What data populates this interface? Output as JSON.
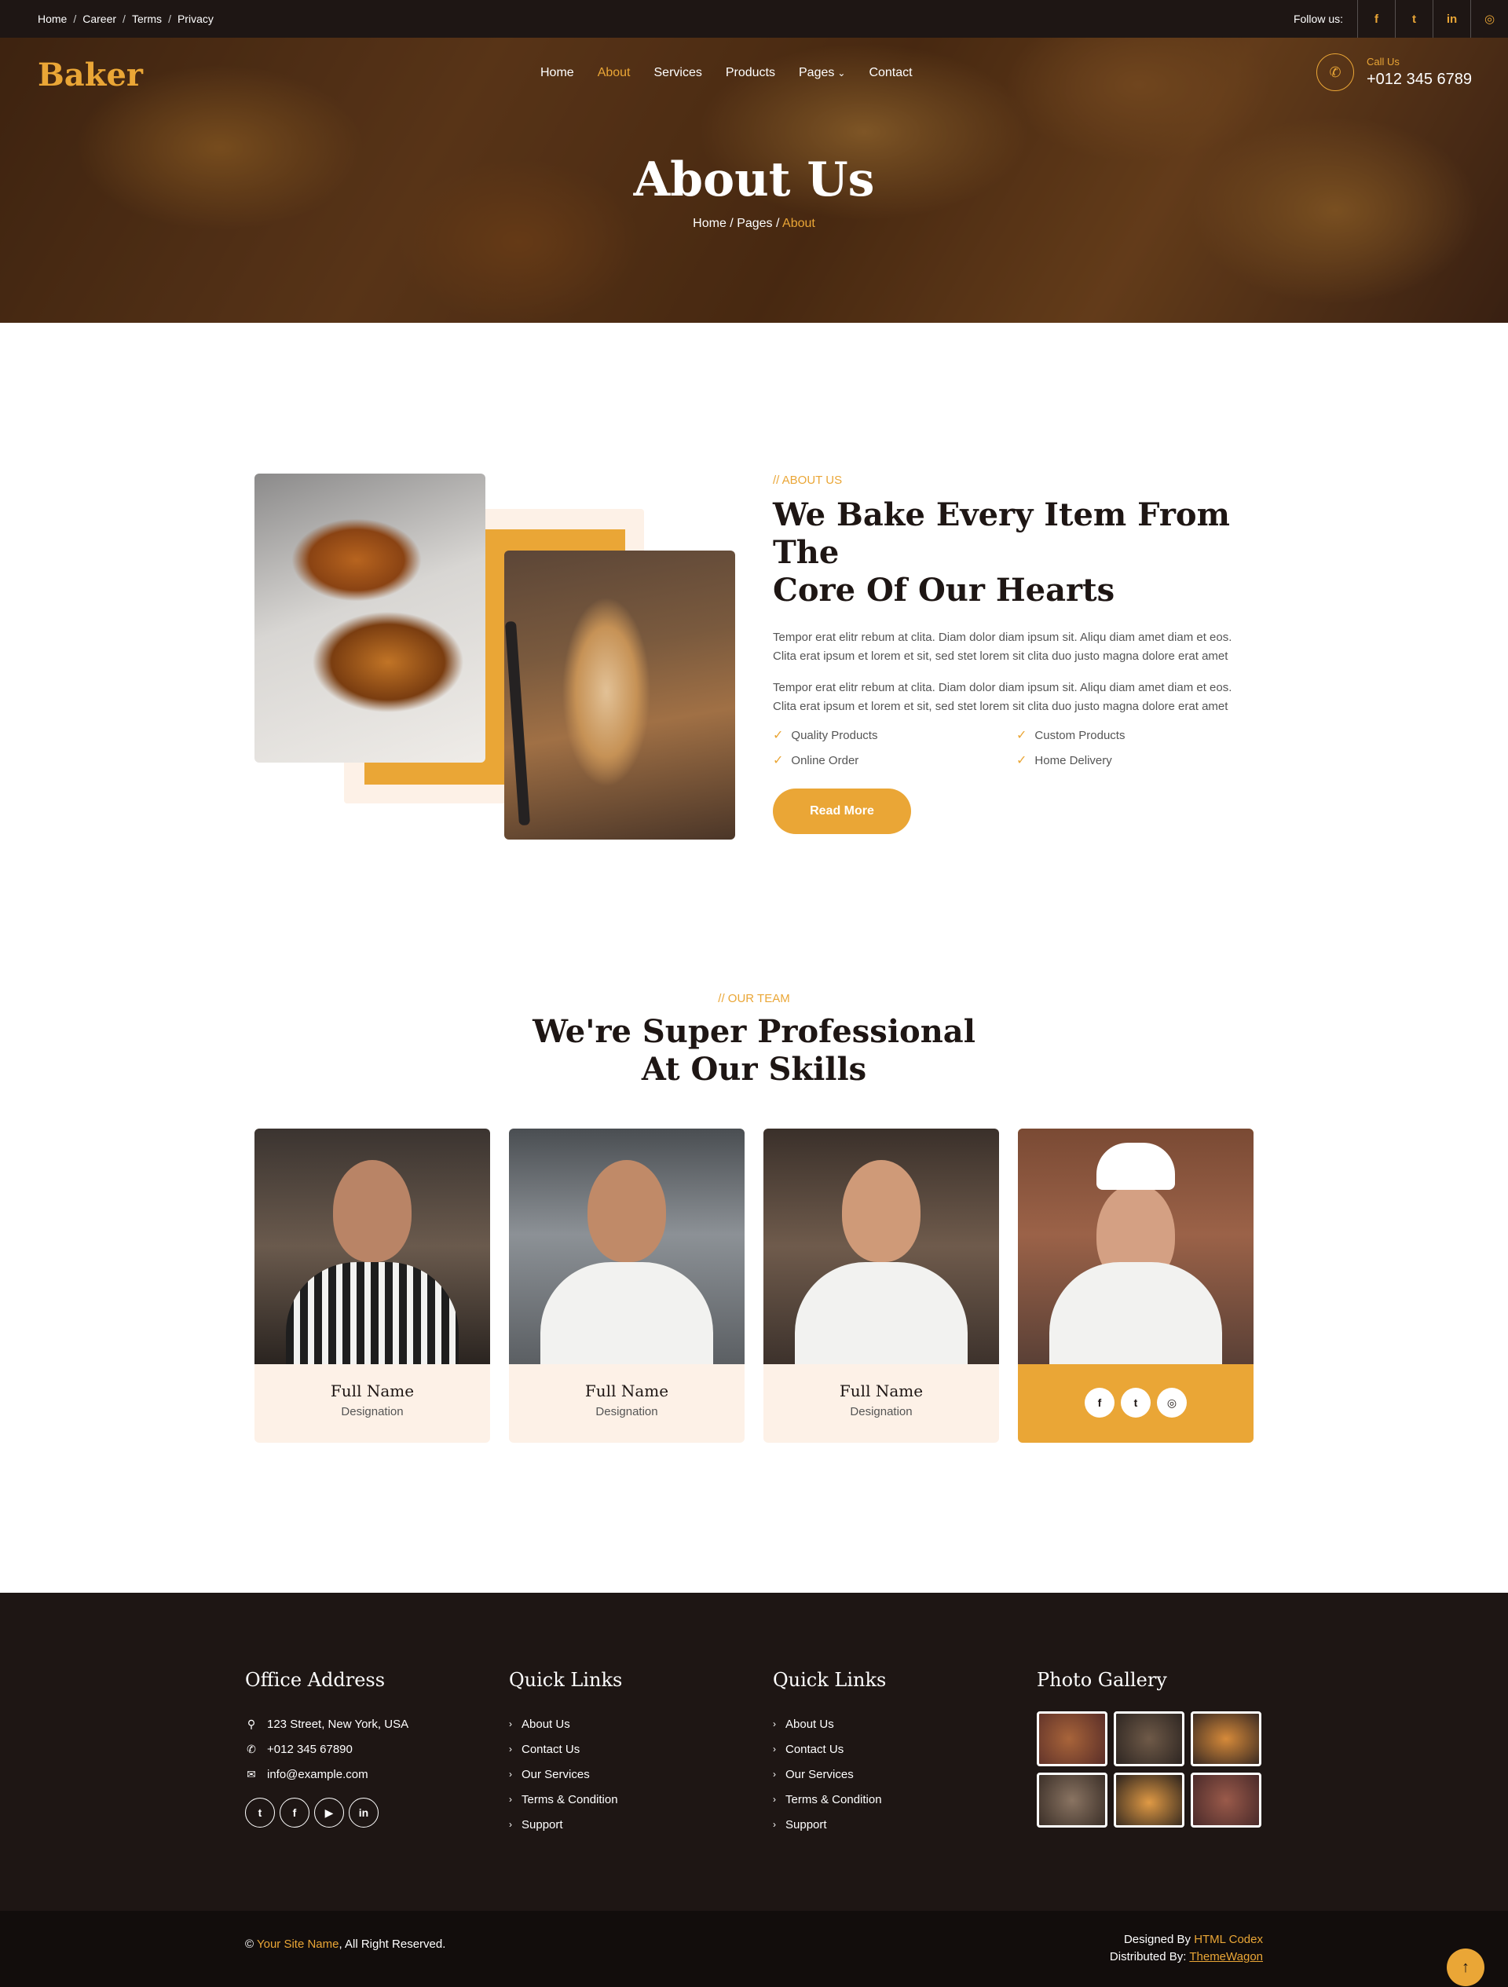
{
  "topbar": {
    "links": [
      "Home",
      "Career",
      "Terms",
      "Privacy"
    ],
    "follow_label": "Follow us:",
    "socials": [
      "facebook-icon",
      "twitter-icon",
      "linkedin-icon",
      "instagram-icon"
    ]
  },
  "header": {
    "logo": "Baker",
    "nav": [
      "Home",
      "About",
      "Services",
      "Products",
      "Pages",
      "Contact"
    ],
    "active_nav": "About",
    "call_label": "Call Us",
    "call_number": "+012 345 6789"
  },
  "hero": {
    "title": "About Us",
    "breadcrumb": [
      "Home",
      "Pages",
      "About"
    ]
  },
  "about": {
    "eyebrow": "// ABOUT US",
    "heading_line1": "We Bake Every Item From The",
    "heading_line2": "Core Of Our Hearts",
    "para1": "Tempor erat elitr rebum at clita. Diam dolor diam ipsum sit. Aliqu diam amet diam et eos. Clita erat ipsum et lorem et sit, sed stet lorem sit clita duo justo magna dolore erat amet",
    "para2": "Tempor erat elitr rebum at clita. Diam dolor diam ipsum sit. Aliqu diam amet diam et eos. Clita erat ipsum et lorem et sit, sed stet lorem sit clita duo justo magna dolore erat amet",
    "features": [
      "Quality Products",
      "Custom Products",
      "Online Order",
      "Home Delivery"
    ],
    "button": "Read More"
  },
  "team": {
    "eyebrow": "// OUR TEAM",
    "heading_line1": "We're Super Professional",
    "heading_line2": "At Our Skills",
    "members": [
      {
        "name": "Full Name",
        "role": "Designation"
      },
      {
        "name": "Full Name",
        "role": "Designation"
      },
      {
        "name": "Full Name",
        "role": "Designation"
      }
    ],
    "card_socials": [
      "facebook-icon",
      "twitter-icon",
      "instagram-icon"
    ]
  },
  "footer": {
    "office_title": "Office Address",
    "address": "123 Street, New York, USA",
    "phone": "+012 345 67890",
    "email": "info@example.com",
    "socials": [
      "twitter-icon",
      "facebook-icon",
      "youtube-icon",
      "linkedin-icon"
    ],
    "quick_title_1": "Quick Links",
    "quick_title_2": "Quick Links",
    "quick_links": [
      "About Us",
      "Contact Us",
      "Our Services",
      "Terms & Condition",
      "Support"
    ],
    "gallery_title": "Photo Gallery"
  },
  "copyright": {
    "symbol": "©",
    "site_name": "Your Site Name",
    "rights": ", All Right Reserved.",
    "designed_by_label": "Designed By ",
    "designed_by": "HTML Codex",
    "distributed_by_label": "Distributed By: ",
    "distributed_by": "ThemeWagon"
  },
  "colors": {
    "accent": "#eaa636",
    "dark": "#1e1614",
    "light": "#fdf1e7"
  }
}
